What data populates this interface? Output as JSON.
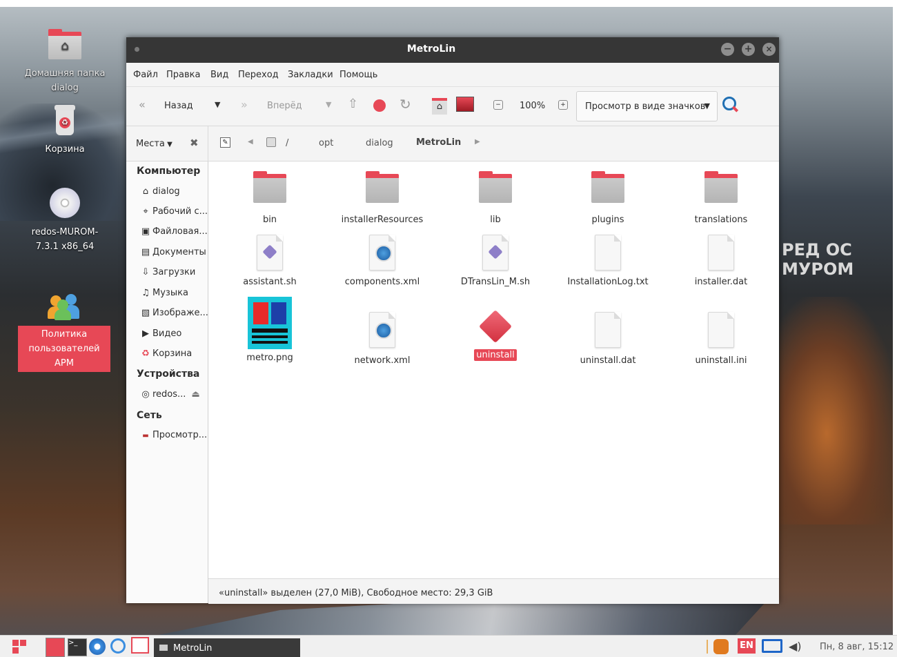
{
  "desktop": {
    "icons": [
      {
        "label": "Домашняя папка dialog"
      },
      {
        "label": "Корзина"
      },
      {
        "label": "redos-MUROM-7.3.1 x86_64"
      },
      {
        "label": "Политика пользователей АРМ"
      }
    ],
    "brand": "РЕД ОС МУРОМ"
  },
  "window": {
    "title": "MetroLin",
    "menu": [
      "Файл",
      "Правка",
      "Вид",
      "Переход",
      "Закладки",
      "Помощь"
    ],
    "toolbar": {
      "back": "Назад",
      "forward": "Вперёд",
      "zoom": "100%",
      "view_mode": "Просмотр в виде значков"
    },
    "places_label": "Места",
    "path": [
      "/",
      "opt",
      "dialog",
      "MetroLin"
    ],
    "sidebar": {
      "computer_header": "Компьютер",
      "computer": [
        "dialog",
        "Рабочий с...",
        "Файловая...",
        "Документы",
        "Загрузки",
        "Музыка",
        "Изображе...",
        "Видео",
        "Корзина"
      ],
      "devices_header": "Устройства",
      "devices": [
        "redos..."
      ],
      "network_header": "Сеть",
      "network": [
        "Просмотр..."
      ]
    },
    "files": [
      {
        "name": "bin",
        "type": "folder"
      },
      {
        "name": "installerResources",
        "type": "folder"
      },
      {
        "name": "lib",
        "type": "folder"
      },
      {
        "name": "plugins",
        "type": "folder"
      },
      {
        "name": "translations",
        "type": "folder"
      },
      {
        "name": "assistant.sh",
        "type": "script"
      },
      {
        "name": "components.xml",
        "type": "xml"
      },
      {
        "name": "DTransLin_M.sh",
        "type": "script"
      },
      {
        "name": "InstallationLog.txt",
        "type": "text"
      },
      {
        "name": "installer.dat",
        "type": "blank"
      },
      {
        "name": "metro.png",
        "type": "image"
      },
      {
        "name": "network.xml",
        "type": "xml"
      },
      {
        "name": "uninstall",
        "type": "executable",
        "selected": true
      },
      {
        "name": "uninstall.dat",
        "type": "blank"
      },
      {
        "name": "uninstall.ini",
        "type": "blank"
      }
    ],
    "status": "«uninstall» выделен (27,0 MiB), Свободное место: 29,3 GiB"
  },
  "taskbar": {
    "task_label": "MetroLin",
    "lang": "EN",
    "clock": "Пн, 8 авг, 15:12"
  },
  "colors": {
    "accent": "#e74856",
    "titlebar": "#363636"
  }
}
